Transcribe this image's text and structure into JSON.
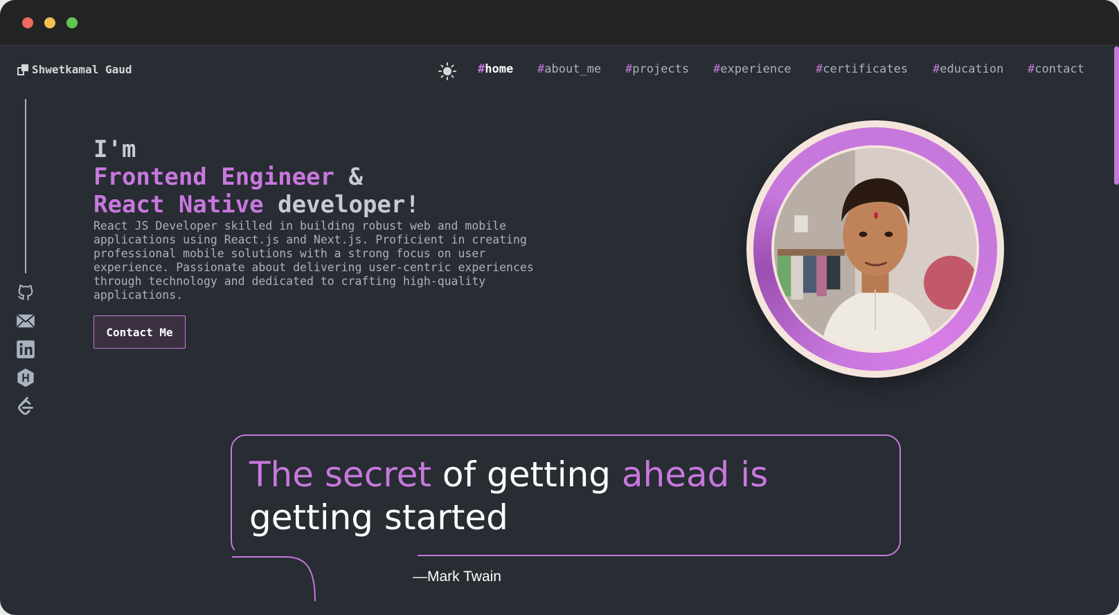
{
  "window": {
    "controls": [
      "close",
      "minimize",
      "maximize"
    ]
  },
  "header": {
    "brand": "Shwetkamal Gaud",
    "theme_icon": "sun-icon",
    "nav": [
      {
        "hash": "#",
        "label": "home",
        "active": true
      },
      {
        "hash": "#",
        "label": "about_me",
        "active": false
      },
      {
        "hash": "#",
        "label": "projects",
        "active": false
      },
      {
        "hash": "#",
        "label": "experience",
        "active": false
      },
      {
        "hash": "#",
        "label": "certificates",
        "active": false
      },
      {
        "hash": "#",
        "label": "education",
        "active": false
      },
      {
        "hash": "#",
        "label": "contact",
        "active": false
      }
    ]
  },
  "social": [
    {
      "icon": "github-icon"
    },
    {
      "icon": "mail-icon"
    },
    {
      "icon": "linkedin-icon"
    },
    {
      "icon": "hashnode-icon"
    },
    {
      "icon": "leetcode-icon"
    }
  ],
  "hero": {
    "line1": "I'm",
    "line2_accent": "Frontend Engineer",
    "line2_rest": " &",
    "line3_accent": "React Native",
    "line3_rest": " developer!",
    "description": "React JS Developer skilled in building robust web and mobile applications using React.js and Next.js. Proficient in creating professional mobile solutions with a strong focus on user experience. Passionate about delivering user-centric experiences through technology and dedicated to crafting high-quality applications.",
    "cta": "Contact Me"
  },
  "quote": {
    "part1": "The secret",
    "part2": " of getting ",
    "part3": "ahead is",
    "part4": " getting started",
    "author": "—Mark Twain"
  },
  "colors": {
    "accent": "#c778dd",
    "background": "#282c33",
    "text": "#abb2bf"
  }
}
